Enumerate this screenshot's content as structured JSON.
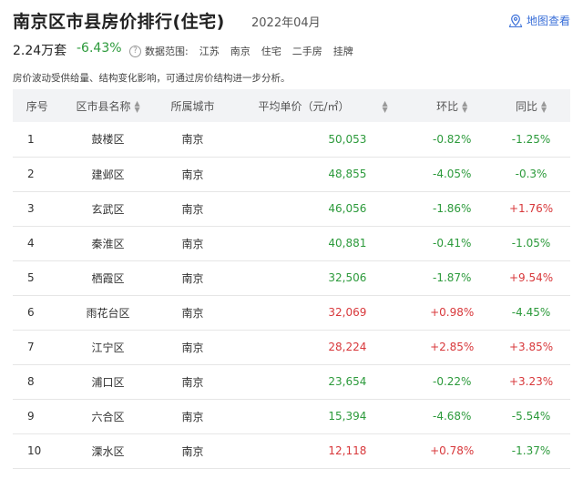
{
  "header": {
    "title": "南京区市县房价排行(住宅)",
    "date": "2022年04月",
    "map_link": "地图查看"
  },
  "summary": {
    "count": "2.24万套",
    "change": "-6.43%",
    "scope_label": "数据范围:",
    "scope_tags": [
      "江苏",
      "南京",
      "住宅",
      "二手房",
      "挂牌"
    ]
  },
  "note": "房价波动受供给量、结构变化影响，可通过房价结构进一步分析。",
  "table": {
    "headers": {
      "idx": "序号",
      "name": "区市县名称",
      "city": "所属城市",
      "price": "平均单价（元/㎡）",
      "mom": "环比",
      "yoy": "同比"
    },
    "rows": [
      {
        "idx": "1",
        "name": "鼓楼区",
        "city": "南京",
        "price": "50,053",
        "mom": "-0.82%",
        "yoy": "-1.25%"
      },
      {
        "idx": "2",
        "name": "建邺区",
        "city": "南京",
        "price": "48,855",
        "mom": "-4.05%",
        "yoy": "-0.3%"
      },
      {
        "idx": "3",
        "name": "玄武区",
        "city": "南京",
        "price": "46,056",
        "mom": "-1.86%",
        "yoy": "+1.76%"
      },
      {
        "idx": "4",
        "name": "秦淮区",
        "city": "南京",
        "price": "40,881",
        "mom": "-0.41%",
        "yoy": "-1.05%"
      },
      {
        "idx": "5",
        "name": "栖霞区",
        "city": "南京",
        "price": "32,506",
        "mom": "-1.87%",
        "yoy": "+9.54%"
      },
      {
        "idx": "6",
        "name": "雨花台区",
        "city": "南京",
        "price": "32,069",
        "mom": "+0.98%",
        "yoy": "-4.45%"
      },
      {
        "idx": "7",
        "name": "江宁区",
        "city": "南京",
        "price": "28,224",
        "mom": "+2.85%",
        "yoy": "+3.85%"
      },
      {
        "idx": "8",
        "name": "浦口区",
        "city": "南京",
        "price": "23,654",
        "mom": "-0.22%",
        "yoy": "+3.23%"
      },
      {
        "idx": "9",
        "name": "六合区",
        "city": "南京",
        "price": "15,394",
        "mom": "-4.68%",
        "yoy": "-5.54%"
      },
      {
        "idx": "10",
        "name": "溧水区",
        "city": "南京",
        "price": "12,118",
        "mom": "+0.78%",
        "yoy": "-1.37%"
      }
    ],
    "price_colors": [
      "green",
      "green",
      "green",
      "green",
      "green",
      "red",
      "red",
      "green",
      "green",
      "red"
    ]
  },
  "colors": {
    "green": "#2c9a3b",
    "red": "#d8383b",
    "link": "#3a6fd8",
    "header_bg": "#f2f3f5"
  }
}
